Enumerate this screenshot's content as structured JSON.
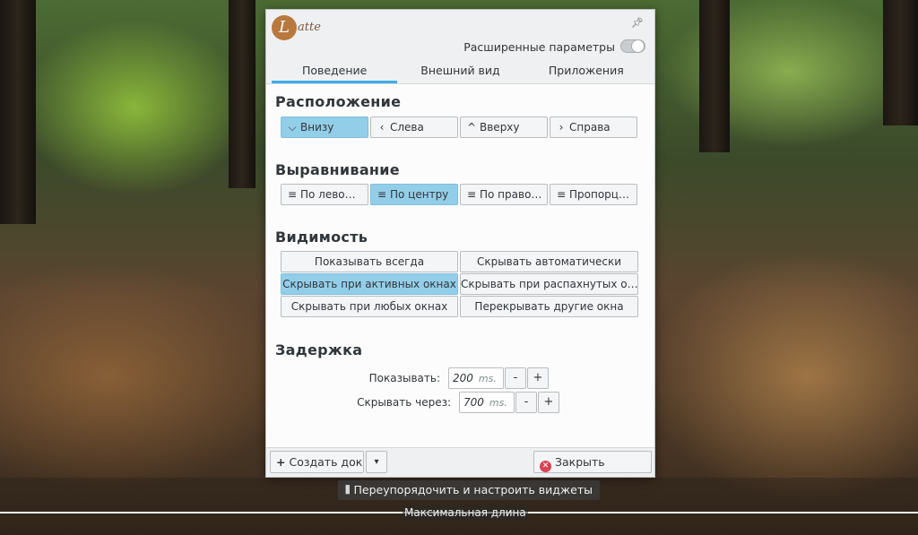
{
  "app": {
    "logo_letter": "L",
    "logo_text": "atte",
    "pin_icon": "pin-icon"
  },
  "header": {
    "advanced_label": "Расширенные параметры",
    "advanced_toggle": false
  },
  "tabs": [
    {
      "label": "Поведение",
      "active": true
    },
    {
      "label": "Внешний вид",
      "active": false
    },
    {
      "label": "Приложения",
      "active": false
    }
  ],
  "location": {
    "title": "Расположение",
    "options": [
      {
        "label": "Внизу",
        "icon": "chevron-down-icon",
        "glyph": "⌵",
        "selected": true
      },
      {
        "label": "Слева",
        "icon": "chevron-left-icon",
        "glyph": "‹",
        "selected": false
      },
      {
        "label": "Вверху",
        "icon": "chevron-up-icon",
        "glyph": "^",
        "selected": false
      },
      {
        "label": "Справа",
        "icon": "chevron-right-icon",
        "glyph": "›",
        "selected": false
      }
    ]
  },
  "alignment": {
    "title": "Выравнивание",
    "options": [
      {
        "label": "По лево…",
        "icon": "align-left-icon",
        "selected": false
      },
      {
        "label": "По центру",
        "icon": "align-center-icon",
        "selected": true
      },
      {
        "label": "По право…",
        "icon": "align-right-icon",
        "selected": false
      },
      {
        "label": "Пропорц…",
        "icon": "align-justify-icon",
        "selected": false
      }
    ]
  },
  "visibility": {
    "title": "Видимость",
    "options": [
      {
        "label": "Показывать всегда",
        "selected": false
      },
      {
        "label": "Скрывать автоматически",
        "selected": false
      },
      {
        "label": "Скрывать при активных окнах",
        "selected": true
      },
      {
        "label": "Скрывать при распахнутых о…",
        "selected": false
      },
      {
        "label": "Скрывать при любых окнах",
        "selected": false
      },
      {
        "label": "Перекрывать другие окна",
        "selected": false
      }
    ]
  },
  "delay": {
    "title": "Задержка",
    "show_label": "Показывать:",
    "show_value": "200",
    "hide_label": "Скрывать через:",
    "hide_value": "700",
    "unit": "ms.",
    "minus": "-",
    "plus": "+"
  },
  "footer": {
    "create_dock": "Создать док",
    "create_icon": "+",
    "dropdown_glyph": "▾",
    "close": "Закрыть",
    "close_glyph": "✕"
  },
  "dock": {
    "rearrange_label": "Переупорядочить и настроить виджеты",
    "max_length_label": "Максимальная длина"
  },
  "colors": {
    "accent": "#3daee9",
    "selected": "#93cee9",
    "close": "#da4453"
  }
}
